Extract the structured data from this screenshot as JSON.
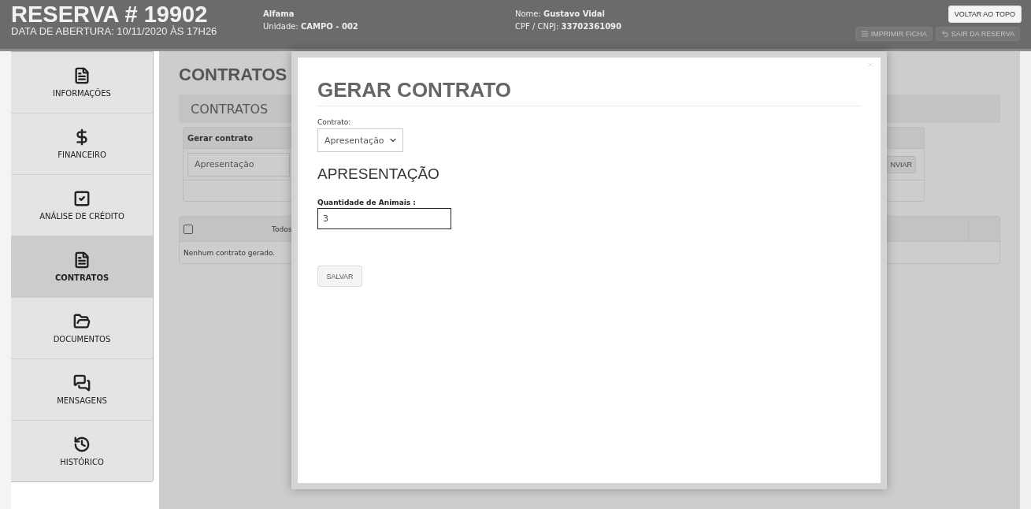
{
  "header": {
    "title": "RESERVA # 19902",
    "subtitle": "DATA DE ABERTURA: 10/11/2020 ÀS 17H26",
    "info_left": [
      {
        "value": "Alfama"
      },
      {
        "label": "Unidade:",
        "value": "CAMPO - 002"
      }
    ],
    "info_right": [
      {
        "label": "Nome:",
        "value": "Gustavo Vidal"
      },
      {
        "label": "CPF / CNPJ:",
        "value": "33702361090"
      }
    ],
    "buttons": [
      "IMPRIMIR FICHA",
      "SAIR DA RESERVA"
    ],
    "back_to_top": "VOLTAR AO TOPO"
  },
  "sidebar": {
    "items": [
      {
        "label": "INFORMAÇÕES",
        "selected": false
      },
      {
        "label": "FINANCEIRO",
        "selected": false
      },
      {
        "label": "ANÁLISE DE CRÉDITO",
        "selected": false
      },
      {
        "label": "CONTRATOS",
        "selected": true
      },
      {
        "label": "DOCUMENTOS",
        "selected": false
      },
      {
        "label": "MENSAGENS",
        "selected": false
      },
      {
        "label": "HISTÓRICO",
        "selected": false
      }
    ]
  },
  "page": {
    "title": "CONTRATOS",
    "panel_title": "CONTRATOS",
    "card_title": "Gerar contrato",
    "card_select": "Apresentação",
    "card_button": "NVIAR",
    "table": {
      "select_all": {
        "label": "Todos",
        "checked": false
      },
      "empty": "Nenhum contrato gerado."
    }
  },
  "modal": {
    "title": "GERAR CONTRATO",
    "contract_label": "Contrato:",
    "contract_value": "Apresentação",
    "section": "APRESENTAÇÃO",
    "field_label": "Quantidade de Animais :",
    "field_value": "3",
    "save": "SALVAR"
  }
}
